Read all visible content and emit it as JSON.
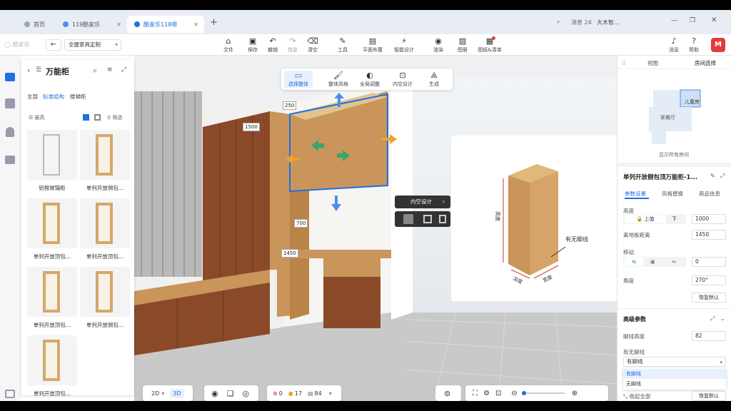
{
  "browser": {
    "tabs": [
      {
        "label": "首页"
      },
      {
        "label": "119酷家乐"
      },
      {
        "label": "酷家乐118嗯"
      }
    ],
    "new_tab": "+",
    "message_count_label": "消息 24",
    "profile_label": "大木智..."
  },
  "toolbar": {
    "project_name": "全屋家具定制",
    "items": [
      "文件",
      "保存",
      "撤销",
      "恢复",
      "清空",
      "工具",
      "平面布置",
      "智能设计",
      "渲染",
      "图册",
      "图纸&清单"
    ],
    "right": [
      "消息",
      "帮助"
    ]
  },
  "left_panel": {
    "title": "万能柜",
    "tabs": [
      "全部",
      "标准结构",
      "楼梯柜"
    ],
    "sort_label": "最高",
    "filter_label": "筛选",
    "items": [
      "铝框玻璃柜",
      "单列开放侧包...",
      "单列开放顶包...",
      "单列开放顶包...",
      "单列开放顶包...",
      "单列开放侧包...",
      "单列开放顶包..."
    ]
  },
  "view_toolbar": {
    "items": [
      "选择整体",
      "整体风格",
      "全局调整",
      "内空设计",
      "生成"
    ]
  },
  "dimensions": {
    "top": "250",
    "height": "1500",
    "mid": "700",
    "low": "1450"
  },
  "context_menu": {
    "label": "内空设计"
  },
  "preview": {
    "label_no_kick": "有无脚线",
    "label_height": "高度",
    "label_depth": "深度",
    "label_width": "宽度"
  },
  "right_panel": {
    "tabs": [
      "视图",
      "房间选择"
    ],
    "room_label": "儿童房",
    "room_label2": "客餐厅",
    "show_all": "显示所有房间",
    "object_title": "单列开放侧包顶万能柜-1...",
    "sub_tabs": [
      "参数设置",
      "风格替换",
      "商品信息"
    ],
    "height_label": "高度",
    "pos_top": "上值",
    "pos_bottom": "下",
    "height_value": "1000",
    "floor_label": "离地板距离",
    "floor_value": "1450",
    "move_label": "移动",
    "move_value": "0",
    "angle_label": "角度",
    "angle_value": "270°",
    "restore_label": "恢复默认",
    "advanced_label": "高级参数",
    "kick_height_label": "脚线高度",
    "kick_height_value": "82",
    "kick_label": "有无脚线",
    "kick_selected": "有脚线",
    "kick_options": [
      "有脚线",
      "无脚线"
    ],
    "collapse_label": "收起全部",
    "restore2": "恢复默认"
  },
  "bottom": {
    "mode_2d": "2D",
    "mode_3d": "3D",
    "err": "0",
    "warn": "17",
    "count": "84"
  },
  "colors": {
    "accent": "#1f6fe0",
    "wood": "#c9955a",
    "dark_wood": "#8a4a2a",
    "brand": "#e23b3b"
  }
}
